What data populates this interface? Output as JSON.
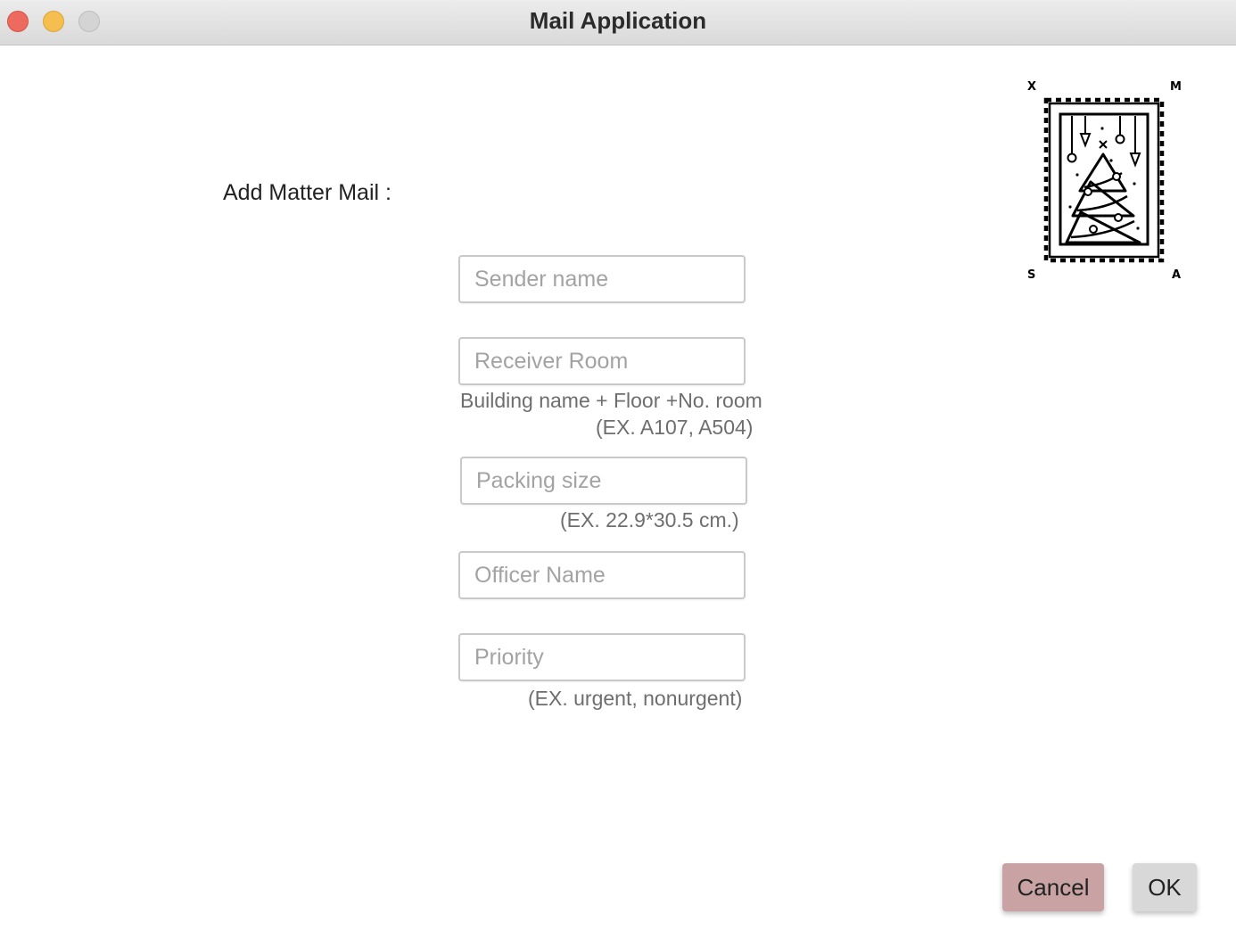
{
  "window": {
    "title": "Mail Application"
  },
  "form": {
    "heading": "Add Matter Mail :",
    "sender": {
      "placeholder": "Sender name",
      "value": ""
    },
    "receiver": {
      "placeholder": "Receiver Room",
      "value": ""
    },
    "receiver_hint_line1": "Building name + Floor +No. room",
    "receiver_hint_line2": "(EX.  A107, A504)",
    "packing": {
      "placeholder": "Packing size",
      "value": ""
    },
    "packing_hint": "(EX.  22.9*30.5 cm.)",
    "officer": {
      "placeholder": "Officer Name",
      "value": ""
    },
    "priority": {
      "placeholder": "Priority",
      "value": ""
    },
    "priority_hint": "(EX.  urgent, nonurgent)"
  },
  "logo": {
    "icon": "christmas-stamp-icon",
    "letters": {
      "top_left": "X",
      "top_right": "M",
      "bottom_left": "S",
      "bottom_right": "A"
    }
  },
  "buttons": {
    "cancel_label": "Cancel",
    "ok_label": "OK",
    "cancel_color": "#c9a3a4",
    "ok_color": "#d8d8d8"
  }
}
